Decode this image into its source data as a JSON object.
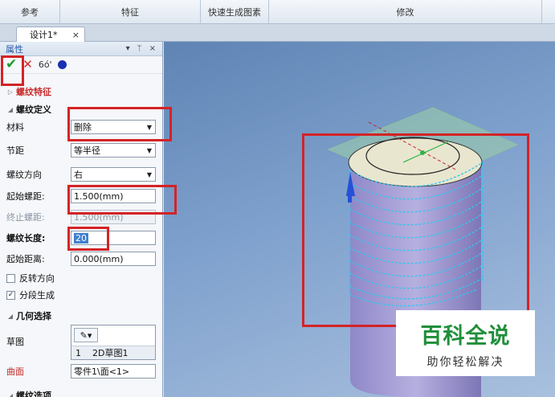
{
  "ribbon": {
    "groups": [
      "参考",
      "特征",
      "快速生成图素",
      "修改"
    ]
  },
  "doc_tab": {
    "label": "设计1*",
    "close": "×"
  },
  "panel": {
    "title": "属性",
    "title_controls": [
      "▾",
      "ᛘ",
      "×"
    ],
    "toolbar": {
      "ok": "✔",
      "cancel": "✕",
      "preview": "6ó'"
    },
    "section_thread_feature": "螺纹特征",
    "section_thread_def": "螺纹定义",
    "fields": {
      "material_label": "材料",
      "material_value": "删除",
      "pitch_label": "节距",
      "pitch_value": "等半径",
      "direction_label": "螺纹方向",
      "direction_value": "右",
      "start_pitch_label": "起始螺距:",
      "start_pitch_value": "1.500(mm)",
      "end_pitch_label": "终止螺距:",
      "end_pitch_value": "1.500(mm)",
      "length_label": "螺纹长度:",
      "length_value": "20",
      "start_dist_label": "起始距离:",
      "start_dist_value": "0.000(mm)"
    },
    "checkboxes": {
      "reverse": {
        "label": "反转方向",
        "checked": false
      },
      "segment": {
        "label": "分段生成",
        "checked": true
      }
    },
    "section_geometry": "几何选择",
    "sketch_label": "草图",
    "sketch_item_index": "1",
    "sketch_item_name": "2D草图1",
    "surface_label": "曲面",
    "surface_value": "零件1\\面<1>",
    "section_thread_options": "螺纹选项"
  },
  "watermark": {
    "main": "百科全说",
    "sub": "助你轻松解决"
  },
  "colors": {
    "accent_red": "#d42326",
    "thread_cyan": "#2ec8f0",
    "viewport_bg": "#7fa1cd"
  }
}
